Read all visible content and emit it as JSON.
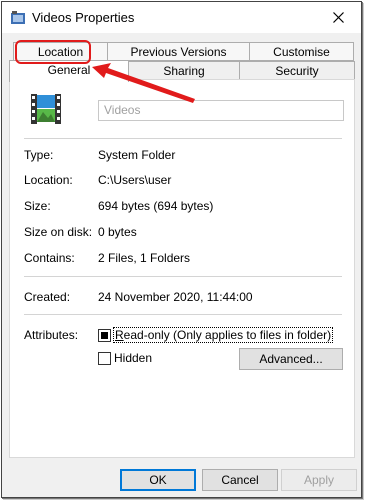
{
  "window": {
    "title": "Videos Properties"
  },
  "tabs": {
    "top_row": [
      "Location",
      "Previous Versions",
      "Customise"
    ],
    "bottom_row": [
      "General",
      "Sharing",
      "Security"
    ],
    "active": "General"
  },
  "general": {
    "folder_name": "Videos",
    "rows": [
      {
        "label": "Type:",
        "value": "System Folder"
      },
      {
        "label": "Location:",
        "value": "C:\\Users\\user"
      },
      {
        "label": "Size:",
        "value": "694 bytes (694 bytes)"
      },
      {
        "label": "Size on disk:",
        "value": "0 bytes"
      },
      {
        "label": "Contains:",
        "value": "2 Files, 1 Folders"
      },
      {
        "label": "Created:",
        "value": "24 November 2020, 11:44:00"
      }
    ],
    "attributes_label": "Attributes:",
    "readonly_label": "Read-only (Only applies to files in folder)",
    "readonly_state": "indeterminate",
    "hidden_label": "Hidden",
    "hidden_checked": false,
    "advanced_label": "Advanced..."
  },
  "buttons": {
    "ok": "OK",
    "cancel": "Cancel",
    "apply": "Apply"
  },
  "annotation": {
    "color": "#e11b1b"
  }
}
